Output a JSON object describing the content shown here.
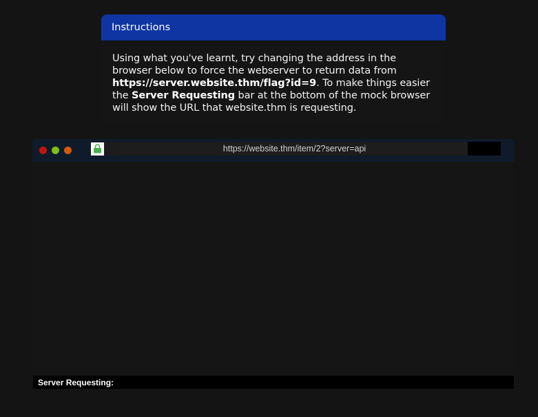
{
  "instructions": {
    "title": "Instructions",
    "text_1": "Using what you've learnt, try changing the address in the browser below to force the webserver to return data from ",
    "flag_url": "https://server.website.thm/flag?id=9",
    "text_2": ". To make things easier the ",
    "server_requesting_bold": "Server Requesting",
    "text_3": " bar at the bottom of the mock browser will show the URL that website.thm is requesting."
  },
  "browser": {
    "url": "https://website.thm/item/2?server=api",
    "window_controls": [
      "close",
      "minimize",
      "maximize"
    ],
    "colors": {
      "close": "#c1140f",
      "minimize": "#7ebd1a",
      "maximize": "#d3590b",
      "titlebar": "#0f1b2b",
      "lock": "#4caf50"
    },
    "lock_icon": "lock-icon"
  },
  "server_requesting": {
    "label": "Server Requesting:",
    "value": ""
  }
}
